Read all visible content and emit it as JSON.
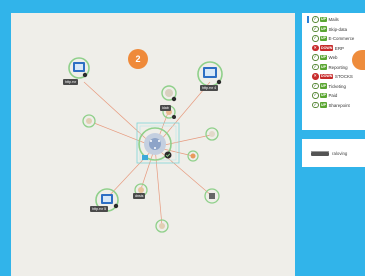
{
  "map": {
    "cluster_count": "2",
    "labels": {
      "left_label": "http.rvr",
      "right_label": "http.rvr 4",
      "top_center_label": "ldab",
      "bottom_left_label": "http.rvr 5",
      "bottom_center_label": "dnsis"
    }
  },
  "services": [
    {
      "status": "UP",
      "name": "Mails"
    },
    {
      "status": "UP",
      "name": "Skip-data"
    },
    {
      "status": "UP",
      "name": "E-Commerce"
    },
    {
      "status": "DOWN",
      "name": "ERP"
    },
    {
      "status": "UP",
      "name": "Web"
    },
    {
      "status": "UP",
      "name": "Reporting"
    },
    {
      "status": "DOWN",
      "name": "STOCKS"
    },
    {
      "status": "UP",
      "name": "Ticketing"
    },
    {
      "status": "UP",
      "name": "Paid"
    },
    {
      "status": "UP",
      "name": "Sharepoint"
    }
  ],
  "device": {
    "name": "raloving"
  },
  "colors": {
    "background": "#31b4ea",
    "up": "#5aa632",
    "down": "#c72b2b",
    "accent": "#ef8a3a"
  }
}
